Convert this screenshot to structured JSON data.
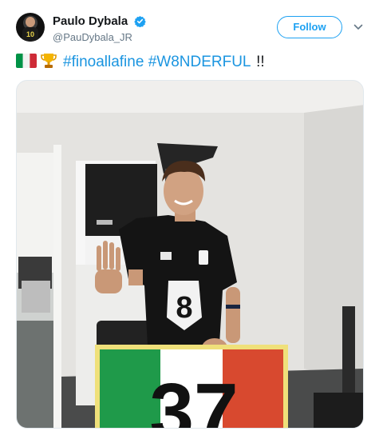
{
  "tweet": {
    "author": {
      "display_name": "Paulo Dybala",
      "handle": "@PauDybala_JR",
      "verified": true,
      "avatar_jersey_number": "10"
    },
    "follow_label": "Follow",
    "text": {
      "emojis": [
        "italy-flag-icon",
        "trophy-icon"
      ],
      "hashtags": [
        "#finoallafine",
        "#W8NDERFUL"
      ],
      "trailing": "!!"
    },
    "photo": {
      "shirt_number": "8",
      "sign_number": "37",
      "sign_colors": [
        "#009246",
        "#ffffff",
        "#ce2b37"
      ]
    }
  },
  "colors": {
    "accent": "#1da1f2",
    "hashtag": "#1b95e0",
    "text": "#14171a",
    "secondary": "#657786"
  }
}
